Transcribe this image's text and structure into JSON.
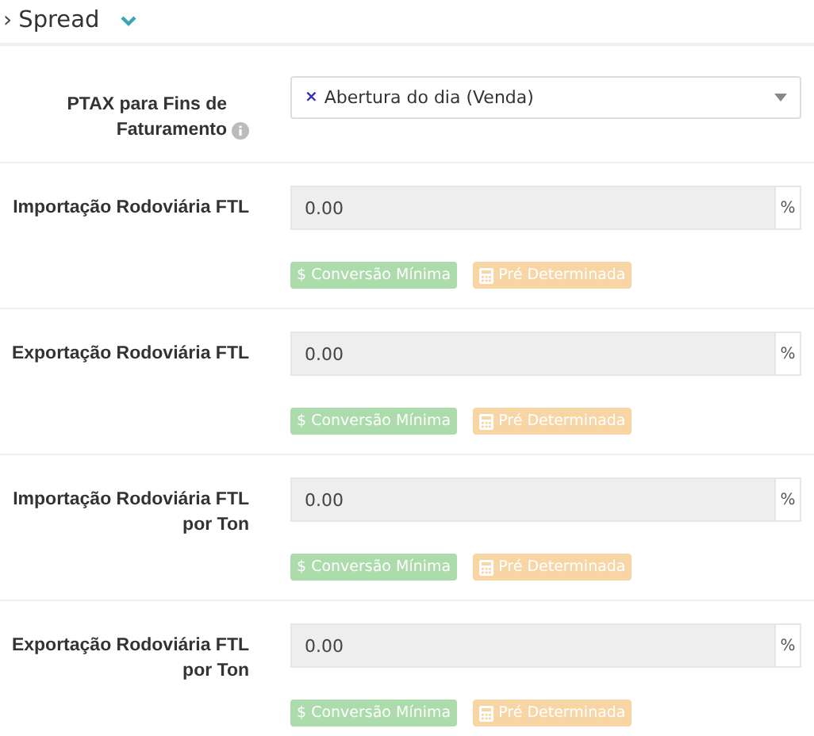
{
  "section": {
    "prefix": "›",
    "title": "Spread",
    "expanded": true
  },
  "ptax": {
    "label": "PTAX para Fins de Faturamento",
    "tag_remove": "×",
    "value": "Abertura do dia (Venda)"
  },
  "rates": [
    {
      "label": "Importação Rodoviária FTL",
      "value": "0.00",
      "unit": "%",
      "buttons": [
        {
          "kind": "money",
          "label": "$ Conversão Mínima",
          "disabled": true
        },
        {
          "kind": "calculator",
          "label": "Pré Determinada",
          "disabled": true
        }
      ]
    },
    {
      "label": "Exportação Rodoviária FTL",
      "value": "0.00",
      "unit": "%",
      "buttons": [
        {
          "kind": "money",
          "label": "$ Conversão Mínima",
          "disabled": true
        },
        {
          "kind": "calculator",
          "label": "Pré Determinada",
          "disabled": true
        }
      ]
    },
    {
      "label": "Importação Rodoviária FTL por Ton",
      "value": "0.00",
      "unit": "%",
      "buttons": [
        {
          "kind": "money",
          "label": "$ Conversão Mínima",
          "disabled": true
        },
        {
          "kind": "calculator",
          "label": "Pré Determinada",
          "disabled": true
        }
      ]
    },
    {
      "label": "Exportação Rodoviária FTL por Ton",
      "value": "0.00",
      "unit": "%",
      "buttons": [
        {
          "kind": "money",
          "label": "$ Conversão Mínima",
          "disabled": true
        },
        {
          "kind": "calculator",
          "label": "Pré Determinada",
          "disabled": true
        }
      ]
    }
  ]
}
